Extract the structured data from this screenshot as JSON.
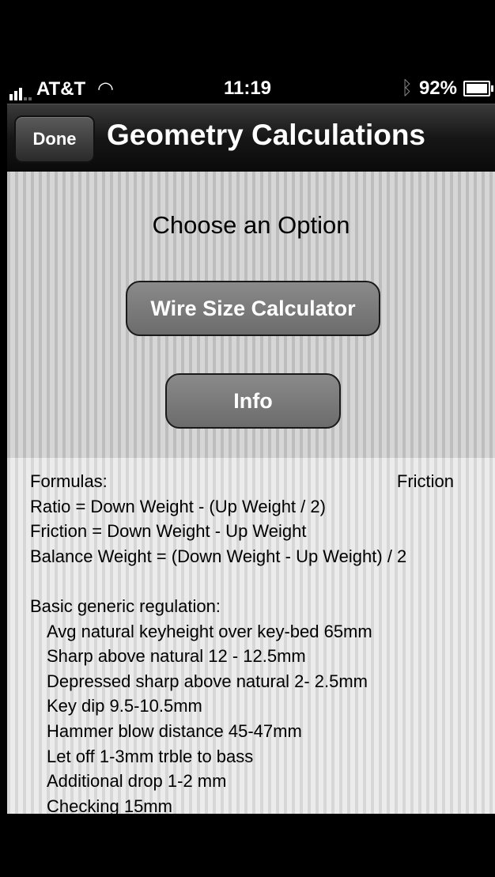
{
  "status_bar": {
    "carrier": "AT&T",
    "time": "11:19",
    "battery": "92%",
    "battery_level": 0.92,
    "icons": [
      "signal-icon",
      "wifi-icon",
      "bluetooth-icon",
      "battery-icon"
    ]
  },
  "navbar": {
    "done_label": "Done",
    "title": "Geometry Calculations"
  },
  "main": {
    "heading": "Choose an Option",
    "wire_button": "Wire Size Calculator",
    "info_button": "Info"
  },
  "text": {
    "formulas": "Formulas:",
    "friction_label": "Friction",
    "ratio": "Ratio = Down Weight - (Up Weight / 2)",
    "friction_formula": "Friction = Down Weight - Up Weight",
    "balance": "Balance Weight = (Down Weight - Up Weight) / 2",
    "regulation_heading": "Basic generic regulation:",
    "regulation": [
      "Avg natural keyheight over key-bed 65mm",
      "Sharp above natural 12 - 12.5mm",
      "Depressed sharp above natural 2- 2.5mm",
      "Key dip 9.5-10.5mm",
      "Hammer blow distance 45-47mm",
      "Let off 1-3mm trble to bass",
      "Additional drop 1-2 mm",
      "Checking 15mm"
    ]
  }
}
